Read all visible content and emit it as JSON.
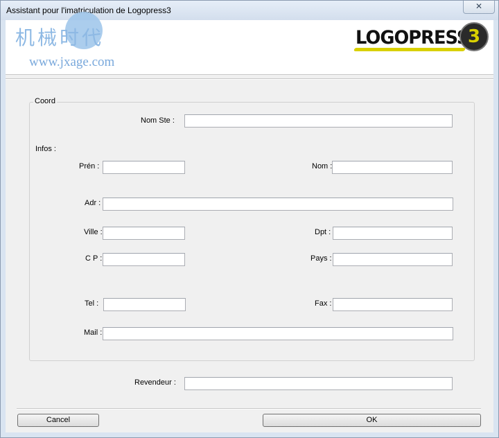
{
  "window": {
    "title": "Assistant pour l'imatriculation de Logopress3",
    "close_glyph": "✕"
  },
  "banner": {
    "watermark_cn": "机械时代",
    "watermark_url": "www.jxage.com",
    "logo_text": "LOGOPRESS",
    "logo_badge": "3",
    "colors": {
      "logo_swoosh": "#d9d000",
      "watermark": "#8eb9e4"
    }
  },
  "form": {
    "group_label": "Coord",
    "nom_ste_label": "Nom Ste :",
    "infos_label": "Infos :",
    "prenom_label": "Prén  :",
    "nom_label": "Nom :",
    "adr_label": "Adr :",
    "ville_label": "Ville :",
    "dpt_label": "Dpt  :",
    "cp_label": "C P :",
    "pays_label": "Pays :",
    "tel_label": "Tel  :",
    "fax_label": "Fax :",
    "mail_label": "Mail :",
    "revendeur_label": "Revendeur :",
    "values": {
      "nom_ste": "",
      "prenom": "",
      "nom": "",
      "adr": "",
      "ville": "",
      "dpt": "",
      "cp": "",
      "pays": "",
      "tel": "",
      "fax": "",
      "mail": "",
      "revendeur": ""
    }
  },
  "buttons": {
    "cancel": "Cancel",
    "ok": "OK"
  }
}
